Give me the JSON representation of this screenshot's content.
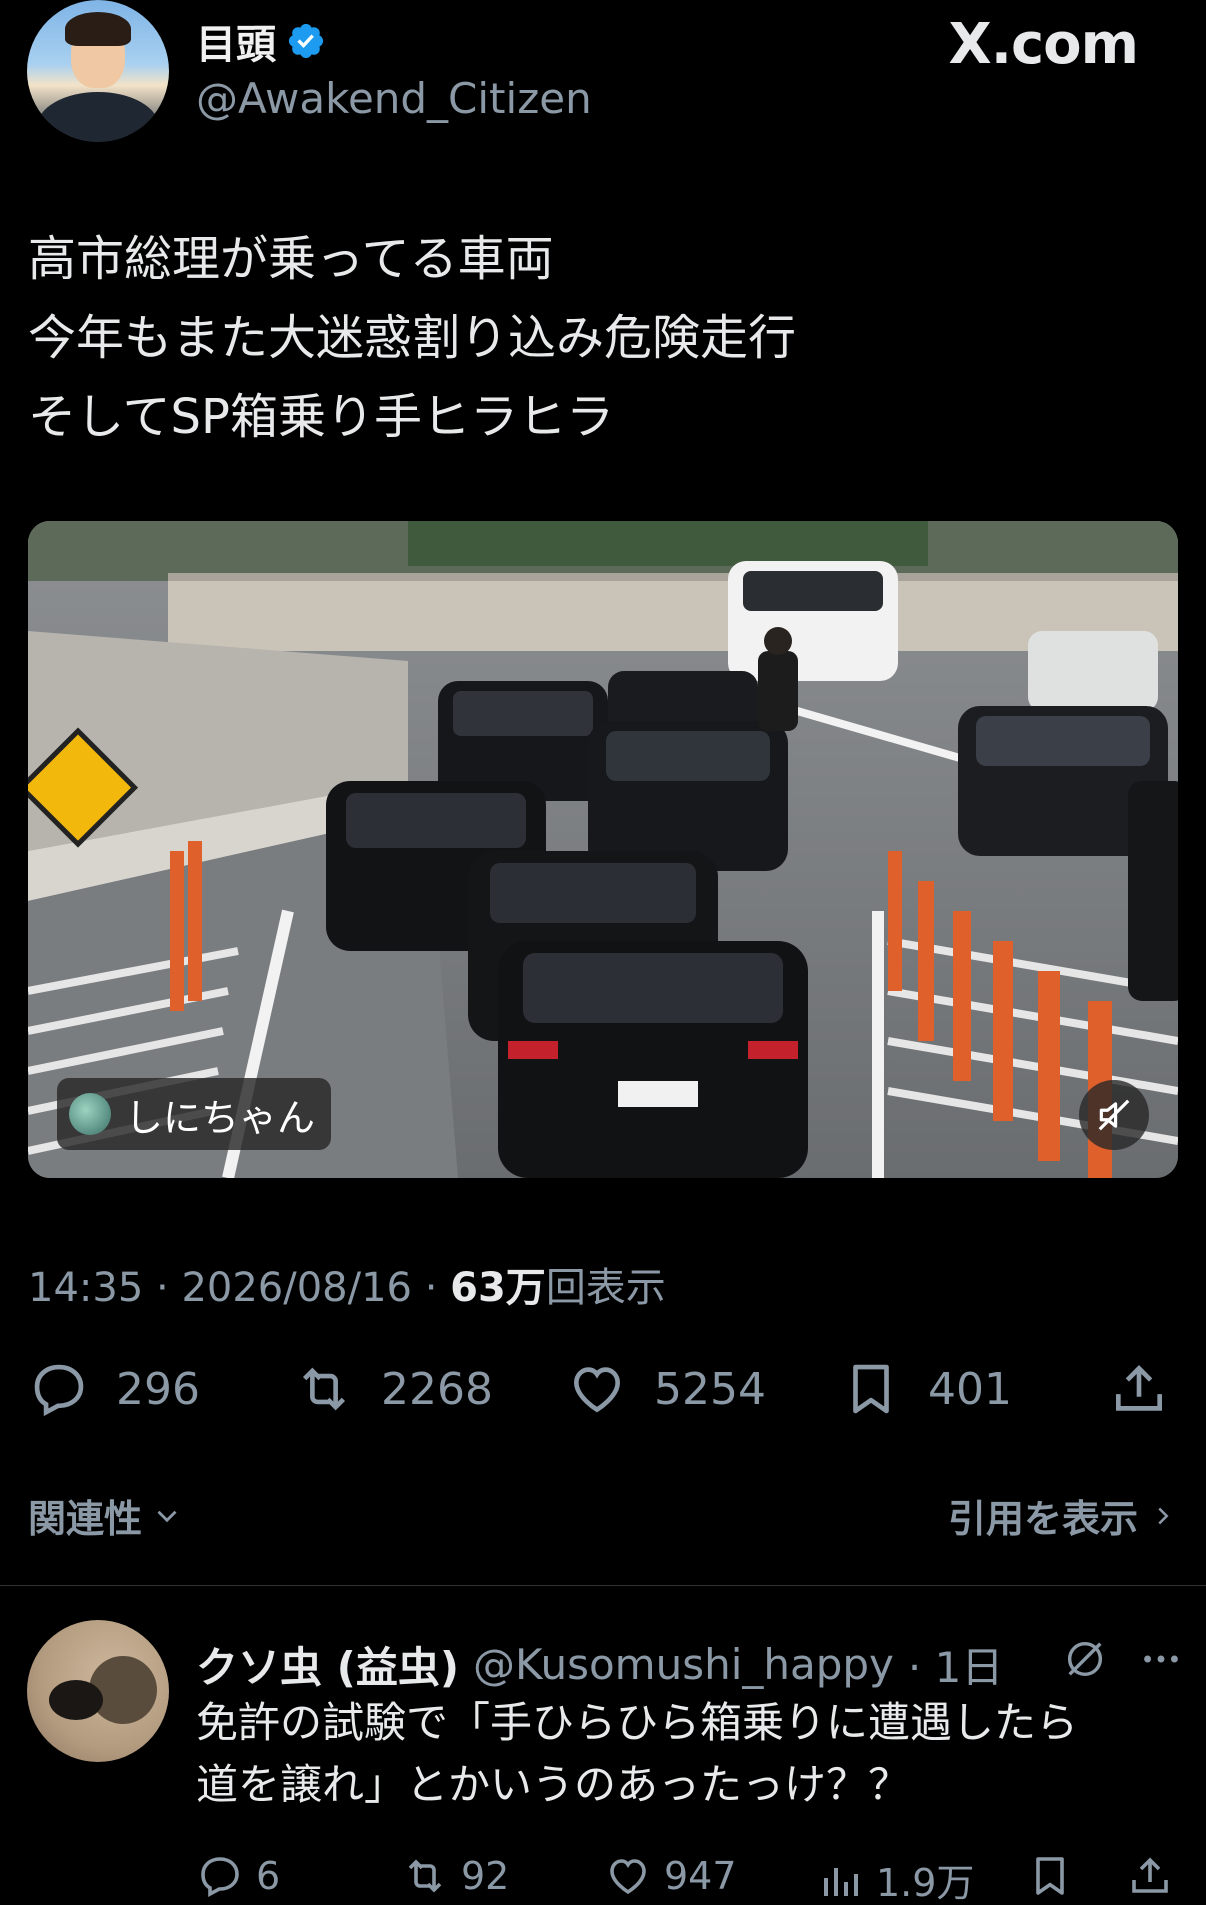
{
  "author": {
    "name": "目頭",
    "handle": "@Awakend_Citizen"
  },
  "watermark": "X.com",
  "tweet": {
    "lines": [
      "高市総理が乗ってる車両",
      "今年もまた大迷惑割り込み危険走行",
      "そしてSP箱乗り手ヒラヒラ"
    ]
  },
  "media": {
    "caption": "しにちゃん",
    "mute_icon": "speaker-muted-icon"
  },
  "meta": {
    "time": "14:35",
    "date": "2026/08/16",
    "views_count": "63万",
    "views_label": "回表示",
    "separator": " · "
  },
  "actions": {
    "replies": "296",
    "reposts": "2268",
    "likes": "5254",
    "bookmarks": "401"
  },
  "sort": {
    "label": "関連性",
    "quotes_link": "引用を表示"
  },
  "reply": {
    "name": "クソ虫 (益虫)",
    "handle": "@Kusomushi_happy",
    "time": "· 1日",
    "lines": [
      "免許の試験で「手ひらひら箱乗りに遭遇したら",
      "道を譲れ」とかいうのあったっけ？？"
    ],
    "replies": "6",
    "reposts": "92",
    "likes": "947",
    "views": "1.9万"
  },
  "colors": {
    "background": "#000000",
    "text": "#e7e9ea",
    "secondary": "#8b98a5",
    "verified": "#1d9bf0"
  }
}
